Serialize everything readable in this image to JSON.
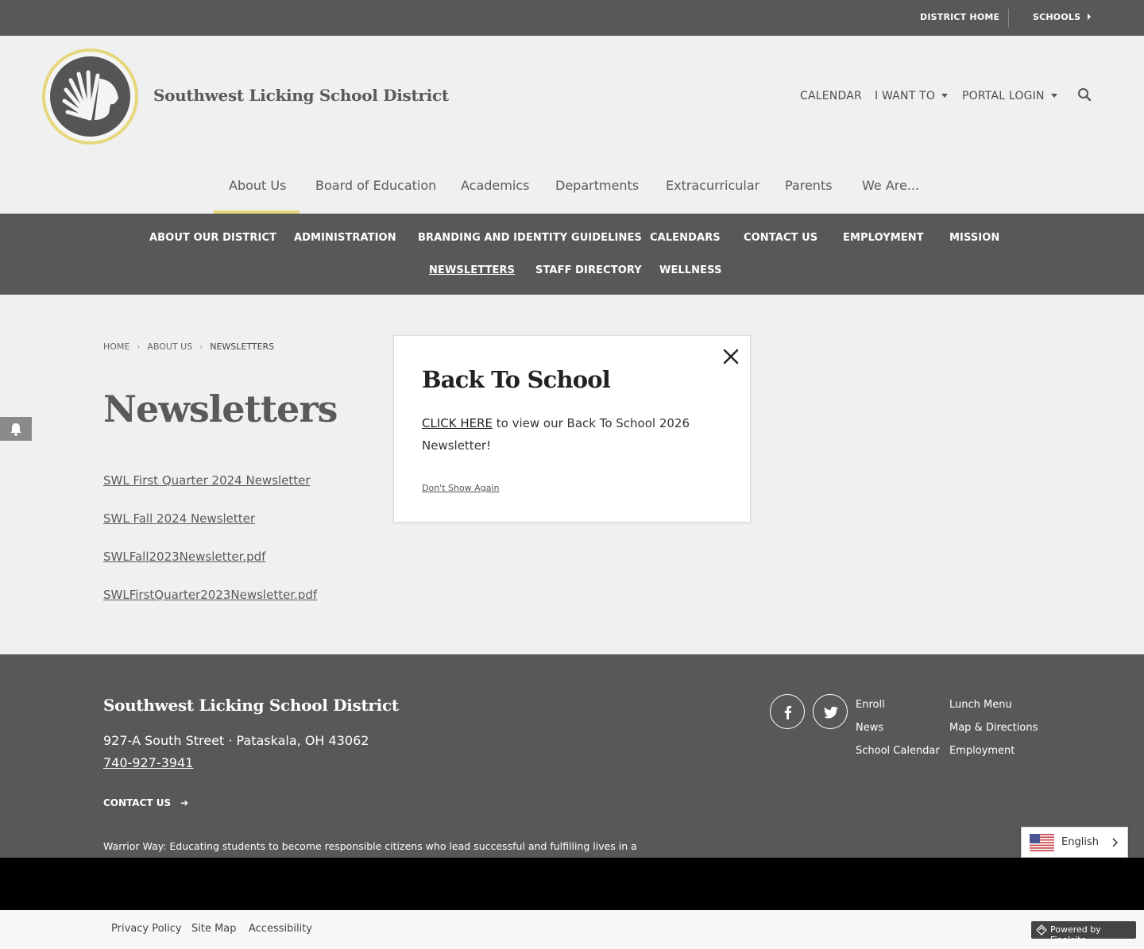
{
  "topbar": {
    "district_home": "DISTRICT HOME",
    "schools": "SCHOOLS"
  },
  "header": {
    "site_title": "Southwest Licking School District",
    "util_nav": [
      "CALENDAR",
      "I WANT TO",
      "PORTAL LOGIN"
    ]
  },
  "main_nav": [
    "About Us",
    "Board of Education",
    "Academics",
    "Departments",
    "Extracurricular",
    "Parents",
    "We Are..."
  ],
  "sub_nav": {
    "row1": [
      "ABOUT OUR DISTRICT",
      "ADMINISTRATION",
      "BRANDING AND IDENTITY GUIDELINES",
      "CALENDARS",
      "CONTACT US",
      "EMPLOYMENT",
      "MISSION"
    ],
    "row2": [
      "NEWSLETTERS",
      "STAFF DIRECTORY",
      "WELLNESS"
    ]
  },
  "breadcrumb": [
    "HOME",
    "ABOUT US",
    "NEWSLETTERS"
  ],
  "page_title": "Newsletters",
  "documents": [
    "SWL First Quarter 2024 Newsletter",
    "SWL Fall 2024 Newsletter",
    "SWLFall2023Newsletter.pdf",
    "SWLFirstQuarter2023Newsletter.pdf"
  ],
  "modal": {
    "title": "Back To School",
    "link_text": "CLICK HERE",
    "body_text": " to view our Back To School 2026 Newsletter!",
    "dismiss": "Don't Show Again"
  },
  "footer": {
    "title": "Southwest Licking School District",
    "address": "927-A South Street  · Pataskala, OH  43062",
    "phone": "740-927-3941",
    "contact": "CONTACT US",
    "mission": "Warrior Way: Educating students to become responsible citizens who lead successful and fulfilling lives in a safe environment.",
    "quick_links_col1": [
      "Enroll",
      "News",
      "School Calendar"
    ],
    "quick_links_col2": [
      "Lunch Menu",
      "Map & Directions",
      "Employment"
    ]
  },
  "language": {
    "label": "English"
  },
  "bottom": {
    "links": [
      "Privacy Policy",
      "Site Map",
      "Accessibility"
    ],
    "powered": "Powered by Finalsite"
  },
  "colors": {
    "accent": "#e6d77d",
    "dark_gray": "#585858",
    "light_bg": "#f0f0f0"
  }
}
